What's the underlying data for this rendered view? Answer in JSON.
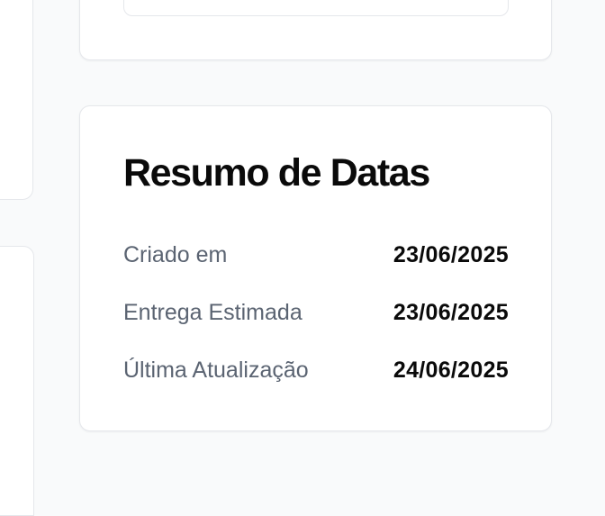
{
  "date_summary": {
    "title": "Resumo de Datas",
    "rows": [
      {
        "label": "Criado em",
        "value": "23/06/2025"
      },
      {
        "label": "Entrega Estimada",
        "value": "23/06/2025"
      },
      {
        "label": "Última Atualização",
        "value": "24/06/2025"
      }
    ]
  },
  "colors": {
    "background": "#f9fafb",
    "card": "#ffffff",
    "border": "#e5e7eb",
    "label": "#5b6472",
    "value": "#0a0a0a"
  }
}
